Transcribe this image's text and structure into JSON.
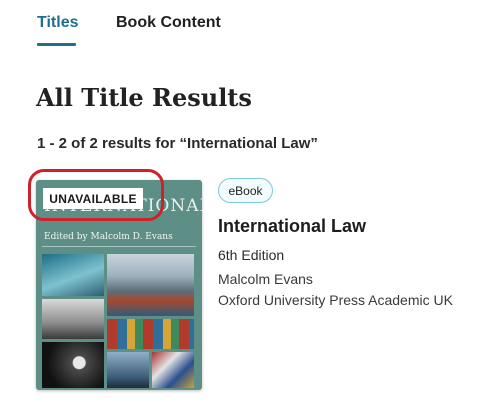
{
  "tabs": [
    {
      "label": "Titles",
      "active": true
    },
    {
      "label": "Book Content",
      "active": false
    }
  ],
  "page_title": "All Title Results",
  "results_summary": "1 - 2 of 2 results for “International Law”",
  "colors": {
    "accent": "#1f6f8b",
    "highlight_ring": "#d0202a",
    "pill_border": "#7fc8d8",
    "cover_background": "#5e8f86"
  },
  "result": {
    "availability_badge": "UNAVAILABLE",
    "format": "eBook",
    "title": "International Law",
    "edition": "6th Edition",
    "author": "Malcolm Evans",
    "publisher": "Oxford University Press Academic UK",
    "cover": {
      "title_text": "INTERNATIONAL LAW",
      "editor_text": "Edited by Malcolm D. Evans"
    }
  }
}
